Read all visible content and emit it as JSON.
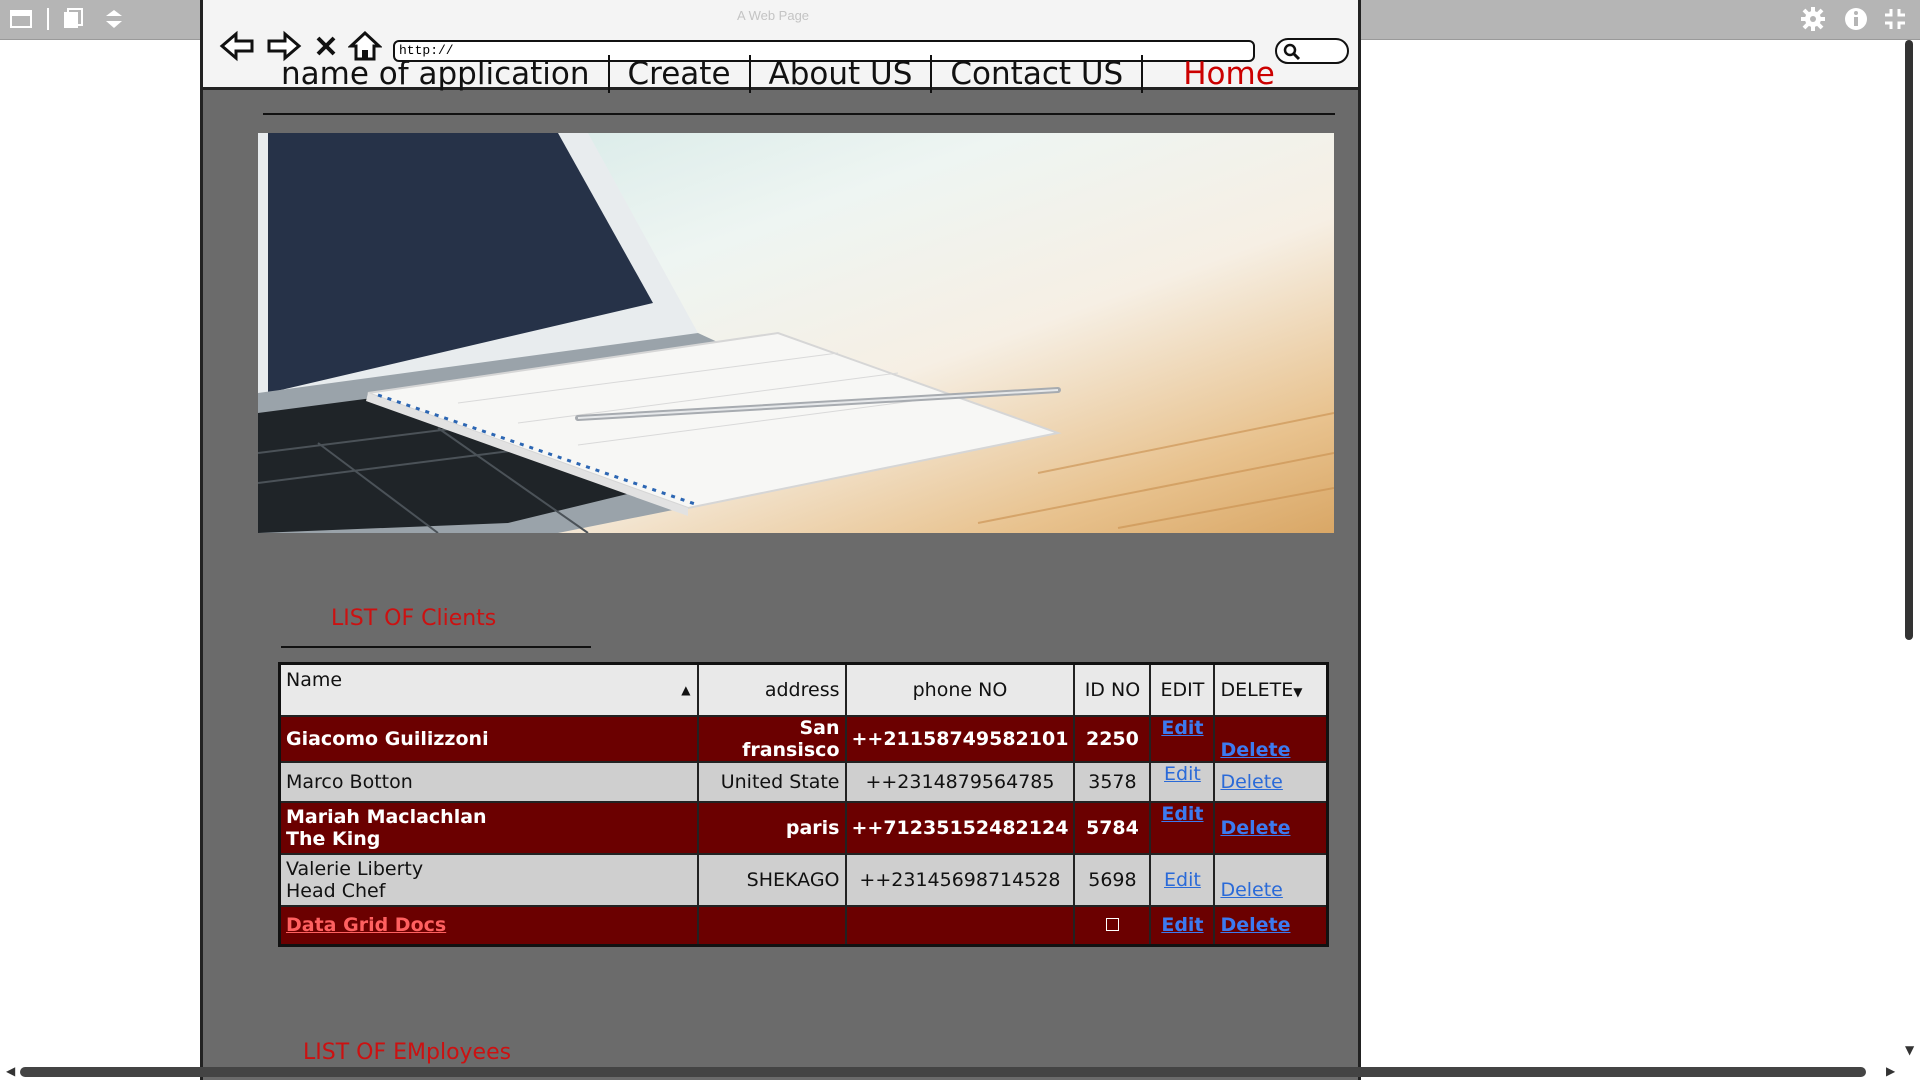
{
  "window": {
    "title": "home"
  },
  "browser": {
    "caption": "A Web Page",
    "url": "http://"
  },
  "menu": {
    "items": [
      {
        "label": "name of application"
      },
      {
        "label": "Create"
      },
      {
        "label": "About US"
      },
      {
        "label": "Contact US"
      },
      {
        "label": "Home"
      }
    ]
  },
  "clients": {
    "title": "LIST OF Clients",
    "columns": [
      "Name",
      "address",
      "phone NO",
      "ID NO",
      "EDIT",
      "DELETE"
    ],
    "rows": [
      {
        "name": "Giacomo Guilizzoni",
        "name2": "",
        "address": "San fransisco",
        "phone": "++21158749582101",
        "id": "2250",
        "edit": "Edit",
        "delete": "Delete"
      },
      {
        "name": "Marco Botton",
        "name2": "",
        "address": "United State",
        "phone": "++2314879564785",
        "id": "3578",
        "edit": "Edit",
        "delete": "Delete"
      },
      {
        "name": "Mariah Maclachlan",
        "name2": "The King",
        "address": "paris",
        "phone": "++71235152482124",
        "id": "5784",
        "edit": "Edit",
        "delete": "Delete"
      },
      {
        "name": "Valerie Liberty",
        "name2": "Head Chef",
        "address": "SHEKAGO",
        "phone": "++23145698714528",
        "id": "5698",
        "edit": "Edit",
        "delete": "Delete"
      },
      {
        "name": "Data Grid Docs",
        "name2": "",
        "address": "",
        "phone": "",
        "id": "",
        "edit": "Edit",
        "delete": "Delete"
      }
    ]
  },
  "employees": {
    "title": "LIST OF EMployees"
  },
  "colors": {
    "accent_red": "#cc1111",
    "row_dark": "#6b0000",
    "frame_bg": "#6b6b6b",
    "link": "#2a6ad8"
  },
  "icons": [
    "panel-icon",
    "copy-icon",
    "chevron-down-icon",
    "gear-icon",
    "info-icon",
    "exit-fullscreen-icon",
    "back-arrow-icon",
    "forward-arrow-icon",
    "close-icon",
    "home-icon",
    "search-icon"
  ]
}
